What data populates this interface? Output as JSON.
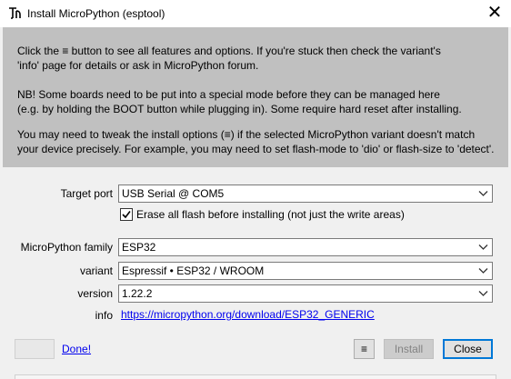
{
  "window": {
    "title": "Install MicroPython (esptool)",
    "close_glyph": "✕"
  },
  "info": {
    "lines": [
      "Click the ≡ button to see all features and options. If you're stuck then check the variant's",
      "'info' page for details or ask in MicroPython forum.",
      "NB! Some boards need to be put into a special mode before they can be managed here",
      "(e.g. by holding the BOOT button while plugging in). Some require hard reset after installing.",
      "You may need to tweak the install options (≡) if the selected MicroPython variant doesn't match",
      "your device precisely. For example, you may need to set flash-mode to 'dio' or flash-size to 'detect'."
    ]
  },
  "form": {
    "target_port_label": "Target port",
    "target_port_value": "USB Serial @ COM5",
    "erase_checked": true,
    "erase_label": "Erase all flash before installing (not just the write areas)",
    "family_label": "MicroPython family",
    "family_value": "ESP32",
    "variant_label": "variant",
    "variant_value": "Espressif • ESP32 / WROOM",
    "version_label": "version",
    "version_value": "1.22.2",
    "info_label": "info",
    "info_url": "https://micropython.org/download/ESP32_GENERIC"
  },
  "footer": {
    "done_label": "Done!",
    "menu_label": "≡",
    "install_label": "Install",
    "close_label": "Close"
  },
  "icons": {
    "app": "thonny-icon",
    "dropdown": "chevron-down-icon",
    "check": "checkmark-icon"
  }
}
